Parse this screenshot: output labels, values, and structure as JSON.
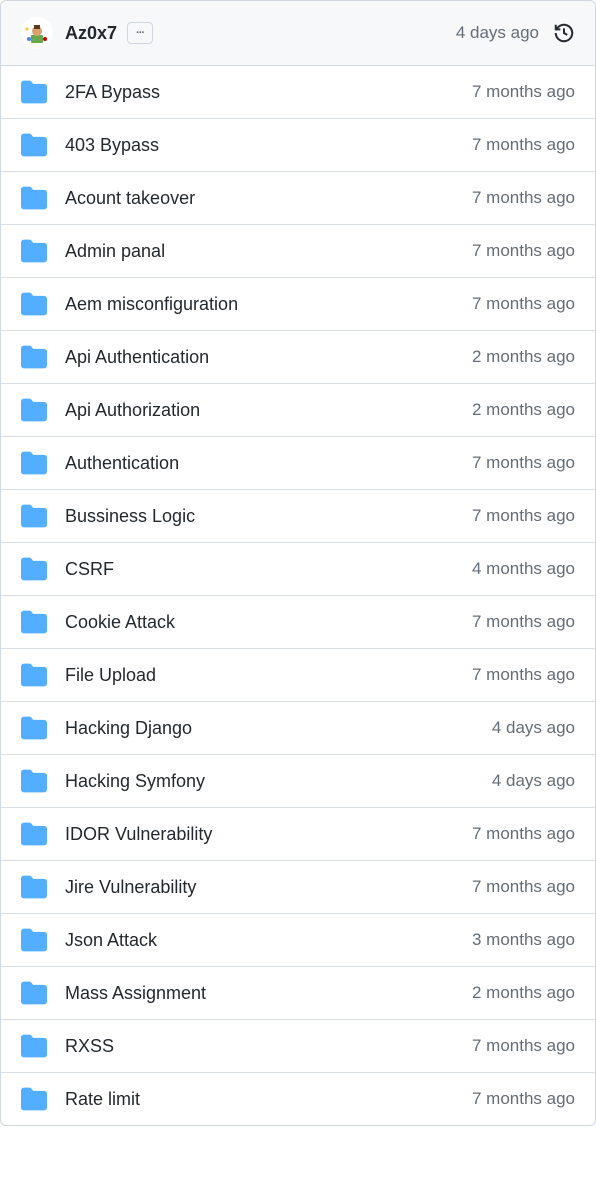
{
  "header": {
    "author": "Az0x7",
    "more_label": "···",
    "time": "4 days ago"
  },
  "files": [
    {
      "name": "2FA Bypass",
      "time": "7 months ago"
    },
    {
      "name": "403 Bypass",
      "time": "7 months ago"
    },
    {
      "name": "Acount takeover",
      "time": "7 months ago"
    },
    {
      "name": "Admin panal",
      "time": "7 months ago"
    },
    {
      "name": "Aem misconfiguration",
      "time": "7 months ago"
    },
    {
      "name": "Api Authentication",
      "time": "2 months ago"
    },
    {
      "name": "Api Authorization",
      "time": "2 months ago"
    },
    {
      "name": "Authentication",
      "time": "7 months ago"
    },
    {
      "name": "Bussiness Logic",
      "time": "7 months ago"
    },
    {
      "name": "CSRF",
      "time": "4 months ago"
    },
    {
      "name": "Cookie Attack",
      "time": "7 months ago"
    },
    {
      "name": "File Upload",
      "time": "7 months ago"
    },
    {
      "name": "Hacking Django",
      "time": "4 days ago"
    },
    {
      "name": "Hacking Symfony",
      "time": "4 days ago"
    },
    {
      "name": "IDOR Vulnerability",
      "time": "7 months ago"
    },
    {
      "name": "Jire Vulnerability",
      "time": "7 months ago"
    },
    {
      "name": "Json Attack",
      "time": "3 months ago"
    },
    {
      "name": "Mass Assignment",
      "time": "2 months ago"
    },
    {
      "name": "RXSS",
      "time": "7 months ago"
    },
    {
      "name": "Rate limit",
      "time": "7 months ago"
    }
  ]
}
